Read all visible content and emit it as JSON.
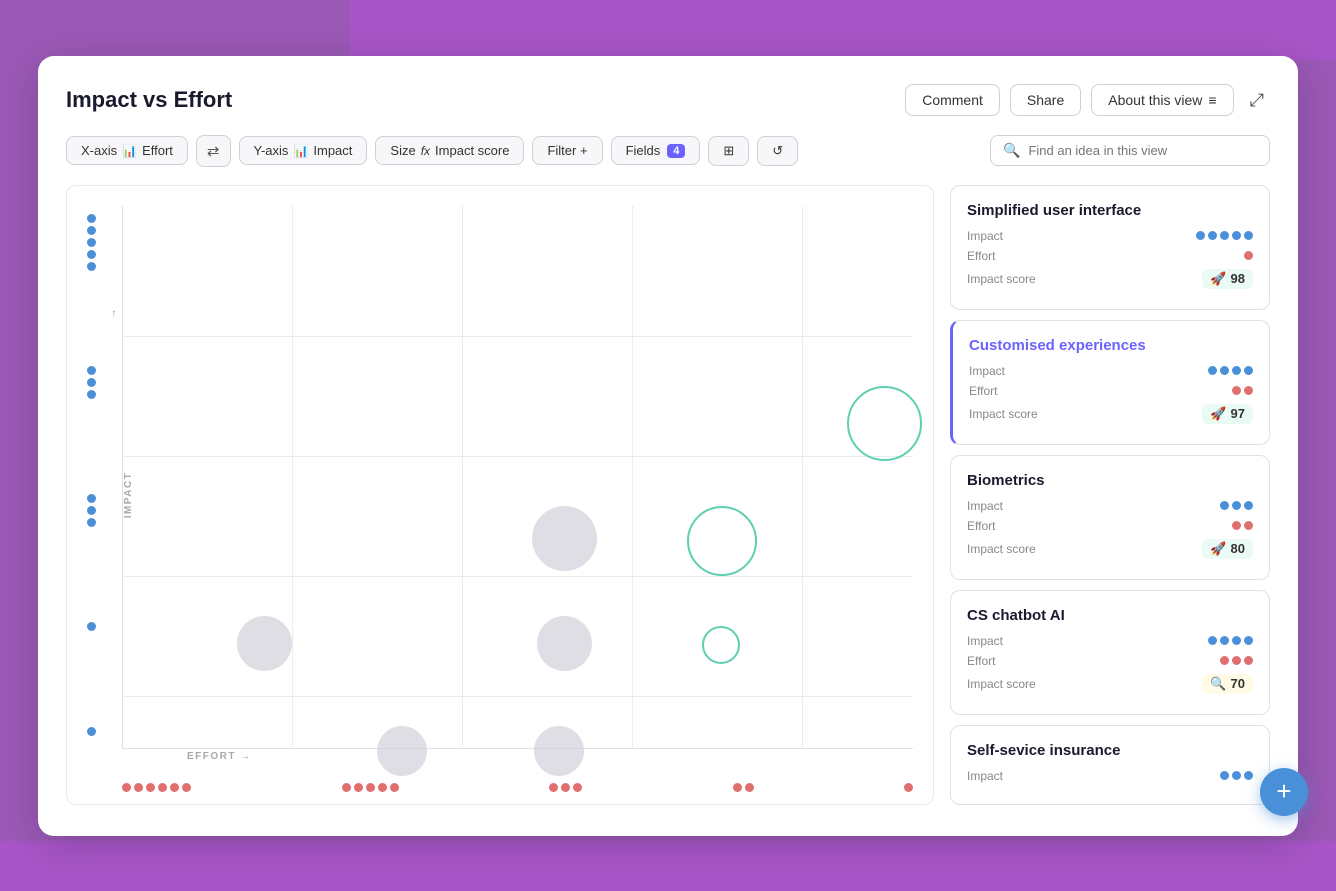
{
  "page": {
    "title": "Impact vs Effort",
    "header_buttons": {
      "comment": "Comment",
      "share": "Share",
      "about": "About this view"
    },
    "toolbar": {
      "xaxis_label": "X-axis",
      "xaxis_value": "Effort",
      "yaxis_label": "Y-axis",
      "yaxis_value": "Impact",
      "size_label": "Size",
      "size_value": "Impact score",
      "filter_label": "Filter +",
      "fields_label": "Fields",
      "fields_count": "4"
    },
    "search_placeholder": "Find an idea in this view",
    "chart": {
      "x_axis_label": "EFFORT →",
      "y_axis_label": "IMPACT"
    },
    "items": [
      {
        "title": "Simplified user interface",
        "impact_dots": 5,
        "effort_dots": 1,
        "impact_score": 98,
        "score_icon": "🚀",
        "score_color": "green-bg"
      },
      {
        "title": "Customised experiences",
        "impact_dots": 4,
        "effort_dots": 2,
        "impact_score": 97,
        "score_icon": "🚀",
        "score_color": "green-bg"
      },
      {
        "title": "Biometrics",
        "impact_dots": 3,
        "effort_dots": 2,
        "impact_score": 80,
        "score_icon": "🚀",
        "score_color": "green-bg"
      },
      {
        "title": "CS chatbot AI",
        "impact_dots": 4,
        "effort_dots": 3,
        "impact_score": 70,
        "score_icon": "🔍",
        "score_color": "yellow-bg"
      },
      {
        "title": "Self-sevice insurance",
        "impact_dots": 3,
        "effort_dots": 0,
        "impact_score": null,
        "score_icon": "",
        "score_color": ""
      }
    ]
  }
}
